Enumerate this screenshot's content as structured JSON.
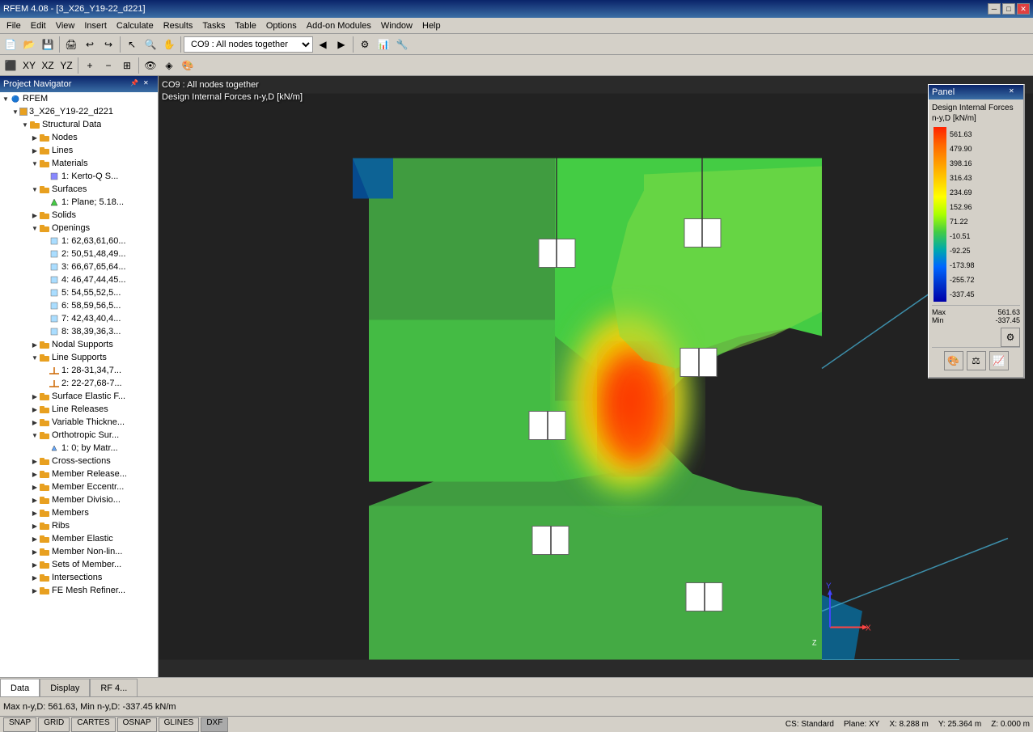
{
  "title_bar": {
    "text": "RFEM 4.08 - [3_X26_Y19-22_d221]",
    "min": "─",
    "max": "□",
    "close": "✕"
  },
  "menu": {
    "items": [
      "File",
      "Edit",
      "View",
      "Insert",
      "Calculate",
      "Results",
      "Tasks",
      "Table",
      "Options",
      "Add-on Modules",
      "Window",
      "Help"
    ]
  },
  "toolbar1": {
    "dropdown_value": "CO9 : All nodes together"
  },
  "viewport": {
    "line1": "CO9 : All nodes together",
    "line2": "Design Internal Forces n-y,D [kN/m]"
  },
  "panel": {
    "title": "Panel",
    "close": "✕",
    "content_title": "Design Internal Forces n-y,D [kN/m]",
    "legend_values": [
      "561.63",
      "479.90",
      "398.16",
      "316.43",
      "234.69",
      "152.96",
      "71.22",
      "-10.51",
      "-92.25",
      "-173.98",
      "-255.72",
      "-337.45"
    ],
    "max_label": "Max",
    "max_value": "561.63",
    "min_label": "Min",
    "min_value": "-337.45"
  },
  "project_navigator": {
    "title": "Project Navigator",
    "tree": [
      {
        "label": "RFEM",
        "level": 0,
        "type": "root",
        "expanded": true
      },
      {
        "label": "3_X26_Y19-22_d221",
        "level": 1,
        "type": "project",
        "expanded": true
      },
      {
        "label": "Structural Data",
        "level": 2,
        "type": "folder",
        "expanded": true
      },
      {
        "label": "Nodes",
        "level": 3,
        "type": "folder"
      },
      {
        "label": "Lines",
        "level": 3,
        "type": "folder"
      },
      {
        "label": "Materials",
        "level": 3,
        "type": "folder",
        "expanded": true
      },
      {
        "label": "1: Kerto-Q S...",
        "level": 4,
        "type": "material"
      },
      {
        "label": "Surfaces",
        "level": 3,
        "type": "folder",
        "expanded": true
      },
      {
        "label": "1: Plane; 5.18...",
        "level": 4,
        "type": "surface"
      },
      {
        "label": "Solids",
        "level": 3,
        "type": "folder"
      },
      {
        "label": "Openings",
        "level": 3,
        "type": "folder",
        "expanded": true
      },
      {
        "label": "1: 62,63,61,60...",
        "level": 4,
        "type": "opening"
      },
      {
        "label": "2: 50,51,48,49...",
        "level": 4,
        "type": "opening"
      },
      {
        "label": "3: 66,67,65,64...",
        "level": 4,
        "type": "opening"
      },
      {
        "label": "4: 46,47,44,45...",
        "level": 4,
        "type": "opening"
      },
      {
        "label": "5: 54,55,52,5...",
        "level": 4,
        "type": "opening"
      },
      {
        "label": "6: 58,59,56,5...",
        "level": 4,
        "type": "opening"
      },
      {
        "label": "7: 42,43,40,4...",
        "level": 4,
        "type": "opening"
      },
      {
        "label": "8: 38,39,36,3...",
        "level": 4,
        "type": "opening"
      },
      {
        "label": "Nodal Supports",
        "level": 3,
        "type": "folder"
      },
      {
        "label": "Line Supports",
        "level": 3,
        "type": "folder",
        "expanded": true
      },
      {
        "label": "1: 28-31,34,7...",
        "level": 4,
        "type": "support"
      },
      {
        "label": "2: 22-27,68-7...",
        "level": 4,
        "type": "support"
      },
      {
        "label": "Surface Elastic F...",
        "level": 3,
        "type": "folder"
      },
      {
        "label": "Line Releases",
        "level": 3,
        "type": "folder"
      },
      {
        "label": "Variable Thickne...",
        "level": 3,
        "type": "folder"
      },
      {
        "label": "Orthotropic Sur...",
        "level": 3,
        "type": "folder",
        "expanded": true
      },
      {
        "label": "1: 0; by Matr...",
        "level": 4,
        "type": "ortho"
      },
      {
        "label": "Cross-sections",
        "level": 3,
        "type": "folder"
      },
      {
        "label": "Member Release...",
        "level": 3,
        "type": "folder"
      },
      {
        "label": "Member Eccentr...",
        "level": 3,
        "type": "folder"
      },
      {
        "label": "Member Divisio...",
        "level": 3,
        "type": "folder"
      },
      {
        "label": "Members",
        "level": 3,
        "type": "folder"
      },
      {
        "label": "Ribs",
        "level": 3,
        "type": "folder"
      },
      {
        "label": "Member Elastic",
        "level": 3,
        "type": "folder"
      },
      {
        "label": "Member Non-lin...",
        "level": 3,
        "type": "folder"
      },
      {
        "label": "Sets of Member...",
        "level": 3,
        "type": "folder"
      },
      {
        "label": "Intersections",
        "level": 3,
        "type": "folder"
      },
      {
        "label": "FE Mesh Refiner...",
        "level": 3,
        "type": "folder"
      }
    ]
  },
  "bottom_tabs": [
    "Data",
    "Display",
    "RF 4..."
  ],
  "status_bar": {
    "text": "Max n-y,D: 561.63, Min n-y,D: -337.45 kN/m"
  },
  "bottom_bar": {
    "buttons": [
      "SNAP",
      "GRID",
      "CARTES",
      "OSNAP",
      "GLINES",
      "DXF"
    ],
    "active": [
      "DXF"
    ],
    "coords": "CS: Standard  Plane: XY  X: 8.288 m      Y: 25.364 m      Z: 0.000 m"
  }
}
